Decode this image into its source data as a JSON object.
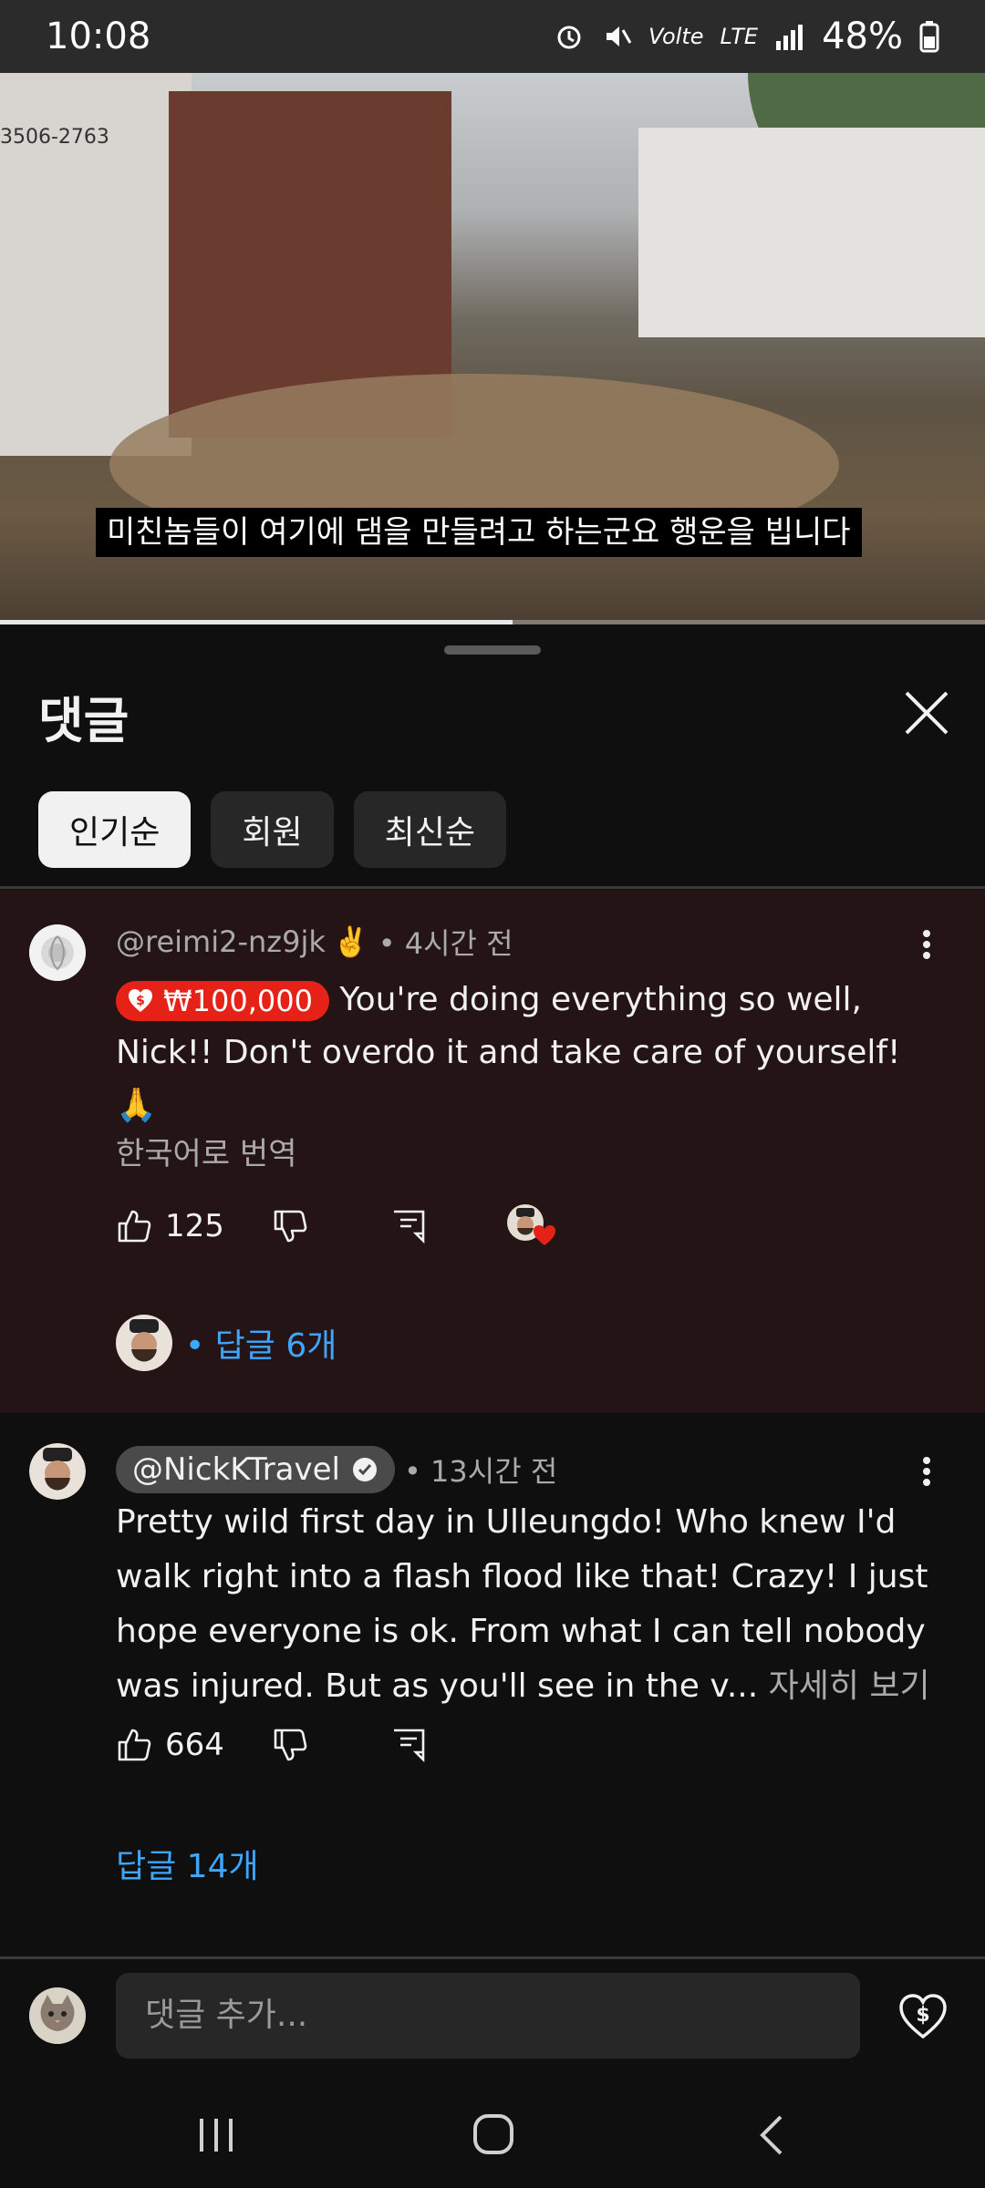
{
  "status": {
    "time": "10:08",
    "battery": "48%",
    "volte": "Volte",
    "net": "LTE"
  },
  "video": {
    "subtitle": "미친놈들이 여기에 댐을 만들려고 하는군요 행운을 빕니다",
    "sign_text": "3506-2763",
    "progress": 0.52
  },
  "sheet": {
    "title": "댓글"
  },
  "chips": [
    "인기순",
    "회원",
    "최신순"
  ],
  "comment1": {
    "author": "@reimi2-nz9jk",
    "author_emoji": "✌️",
    "time": "• 4시간 전",
    "super_amount": "₩100,000",
    "text_line1": "You're doing everything so well,",
    "text_line2": "Nick!! Don't overdo it and take care of yourself!🙏",
    "translate": "한국어로 번역",
    "likes": "125",
    "replies": "• 답글 6개"
  },
  "comment2": {
    "author": "@NickKTravel",
    "time": "• 13시간 전",
    "lines": [
      "Pretty wild first day in Ulleungdo! Who knew I'd",
      "walk right into a flash flood like that! Crazy! I just",
      "hope everyone is ok. From what I can tell nobody",
      "was injured. But as you'll see in the v..."
    ],
    "more": " 자세히 보기",
    "likes": "664",
    "replies": "답글 14개"
  },
  "composer": {
    "placeholder": "댓글 추가..."
  },
  "colors": {
    "accent_blue": "#3ea6ff",
    "super_red": "#e62117",
    "highlight_bg": "#241416"
  }
}
